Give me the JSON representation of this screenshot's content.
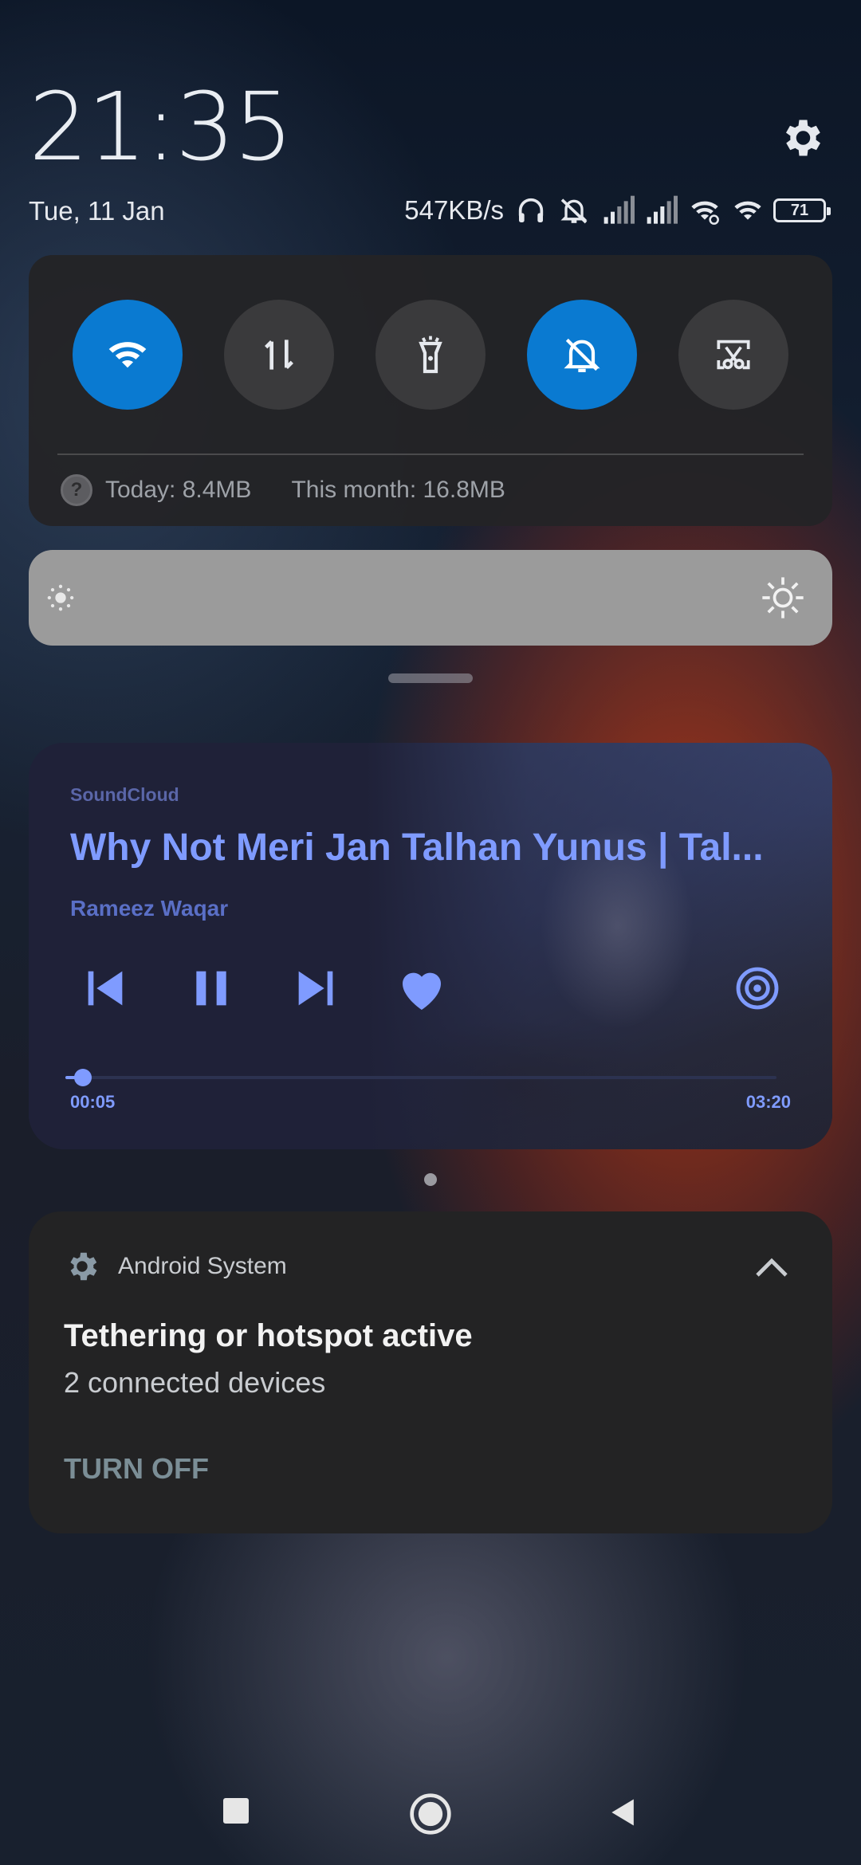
{
  "header": {
    "time": "21:35",
    "date": "Tue, 11 Jan",
    "network_speed": "547KB/s",
    "battery_level": "71"
  },
  "quick_settings": {
    "tiles": [
      {
        "name": "wifi",
        "active": true
      },
      {
        "name": "mobile-data",
        "active": false
      },
      {
        "name": "flashlight",
        "active": false
      },
      {
        "name": "mute",
        "active": true
      },
      {
        "name": "screenshot",
        "active": false
      }
    ],
    "data_today": "Today: 8.4MB",
    "data_month": "This month: 16.8MB"
  },
  "brightness": {
    "level": 0.0
  },
  "media": {
    "app": "SoundCloud",
    "title": "Why Not Meri Jan Talhan Yunus | Tal...",
    "artist": "Rameez Waqar",
    "elapsed": "00:05",
    "duration": "03:20",
    "progress": 0.025,
    "accent_color": "#7f9bff"
  },
  "notification": {
    "app": "Android System",
    "title": "Tethering or hotspot active",
    "text": "2 connected devices",
    "action": "TURN OFF"
  },
  "colors": {
    "active_tile": "#0a7ad1",
    "inactive_tile": "#3a3a3c"
  }
}
